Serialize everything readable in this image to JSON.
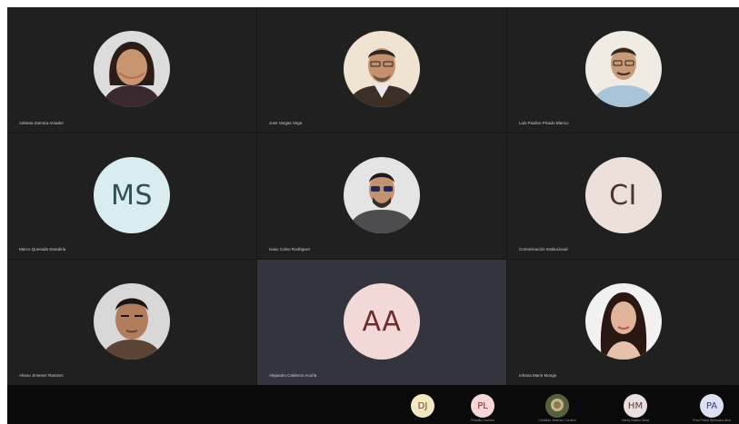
{
  "colors": {
    "ms_bg": "#d9ecef",
    "ms_fg": "#2f4f57",
    "ci_bg": "#ede0da",
    "ci_fg": "#4a3530",
    "aa_bg": "#f3d8d8",
    "aa_fg": "#6b2c2c",
    "dj_bg": "#f4e7c4",
    "pl_bg": "#f6d6d6",
    "hm_bg": "#e9dfdf",
    "pa_bg": "#dde0f3"
  },
  "participants": [
    {
      "name": "Adriana Zamora Amador",
      "initials": ""
    },
    {
      "name": "Jose Vargas Vega",
      "initials": ""
    },
    {
      "name": "Luis Paulino Picado Blanco",
      "initials": ""
    },
    {
      "name": "Marco Quesada Sanabria",
      "initials": "MS"
    },
    {
      "name": "Isaac Calvo Rodriguez",
      "initials": ""
    },
    {
      "name": "Comunicación Institucional",
      "initials": "CI"
    },
    {
      "name": "Alvaro Jimenez Ramirez",
      "initials": ""
    },
    {
      "name": "Alejandro Calderon Acuña",
      "initials": "AA"
    },
    {
      "name": "Iohana Marin Monge",
      "initials": ""
    }
  ],
  "thumbnails": [
    {
      "initials": "DJ",
      "name": ""
    },
    {
      "initials": "PL",
      "name": "Priscilla Leandro"
    },
    {
      "initials": "",
      "name": "Christian Jimenez Cordero"
    },
    {
      "initials": "HM",
      "name": "Henry Solano Mora"
    },
    {
      "initials": "PA",
      "name": "Prod Priscil Spezzano Alva"
    }
  ]
}
